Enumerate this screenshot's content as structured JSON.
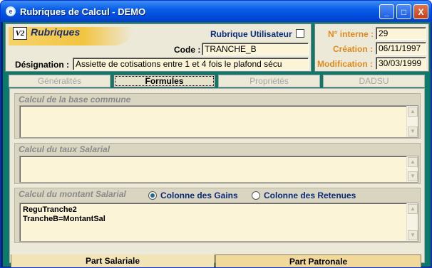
{
  "window": {
    "title": "Rubriques de Calcul - DEMO"
  },
  "titlebar_buttons": {
    "minimize": "_",
    "maximize": "□",
    "close": "X"
  },
  "header": {
    "logo_text": "V2",
    "section_title": "Rubriques",
    "rubrique_utilisateur_label": "Rubrique Utilisateur",
    "rubrique_utilisateur_checked": false,
    "code_label": "Code :",
    "code_value": "TRANCHE_B",
    "designation_label": "Désignation :",
    "designation_value": "Assiette de cotisations entre 1 et 4 fois le plafond sécu"
  },
  "info": {
    "numero_label": "N° interne :",
    "numero_value": "29",
    "creation_label": "Création :",
    "creation_value": "06/11/1997",
    "modification_label": "Modification :",
    "modification_value": "30/03/1999"
  },
  "tabs": [
    {
      "label": "Généralités",
      "active": false
    },
    {
      "label": "Formules",
      "active": true
    },
    {
      "label": "Propriétés",
      "active": false
    },
    {
      "label": "DADSU",
      "active": false
    }
  ],
  "groups": {
    "base_commune": {
      "title": "Calcul de la base commune",
      "content": ""
    },
    "taux_salarial": {
      "title": "Calcul du taux Salarial",
      "content": ""
    },
    "montant_salarial": {
      "title": "Calcul du montant Salarial",
      "radio_gains": "Colonne des Gains",
      "radio_retenues": "Colonne des Retenues",
      "selected": "gains",
      "content": "ReguTranche2\nTrancheB=MontantSal"
    }
  },
  "bottom_tabs": [
    {
      "label": "Part Salariale",
      "active": true
    },
    {
      "label": "Part Patronale",
      "active": false
    }
  ],
  "colors": {
    "panel_teal": "#0b7a6b",
    "field_bg": "#fbf4d6",
    "info_orange": "#e08a1e",
    "title_blue": "#0a5ee8"
  }
}
